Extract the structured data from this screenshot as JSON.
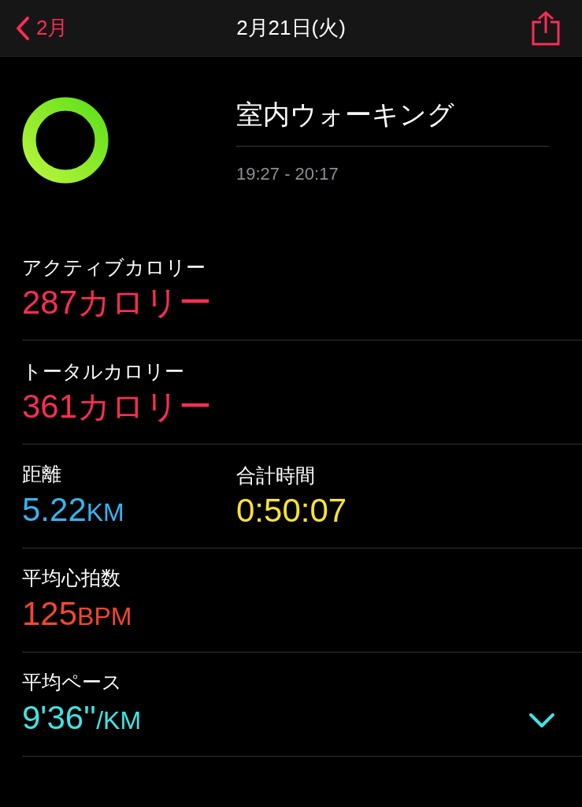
{
  "nav": {
    "back": "2月",
    "title": "2月21日(火)"
  },
  "workout": {
    "title": "室内ウォーキング",
    "time": "19:27 - 20:17"
  },
  "metrics": [
    {
      "cells": [
        {
          "label": "アクティブカロリー",
          "value": "287カロリー",
          "color": "#fa2d55"
        }
      ]
    },
    {
      "cells": [
        {
          "label": "トータルカロリー",
          "value": "361カロリー",
          "color": "#fa2d55"
        }
      ]
    },
    {
      "cells": [
        {
          "label": "距離",
          "value": "5.22",
          "unit": "KM",
          "color": "#35b4f2"
        },
        {
          "label": "合計時間",
          "value": "0:50:07",
          "color": "#f7e232"
        }
      ]
    },
    {
      "cells": [
        {
          "label": "平均心拍数",
          "value": "125",
          "unit": "BPM",
          "color": "#f5462f"
        }
      ]
    },
    {
      "cells": [
        {
          "label": "平均ペース",
          "value": "9'36''",
          "unit": "/KM",
          "color": "#40e3e3"
        }
      ],
      "expanded": false
    }
  ]
}
